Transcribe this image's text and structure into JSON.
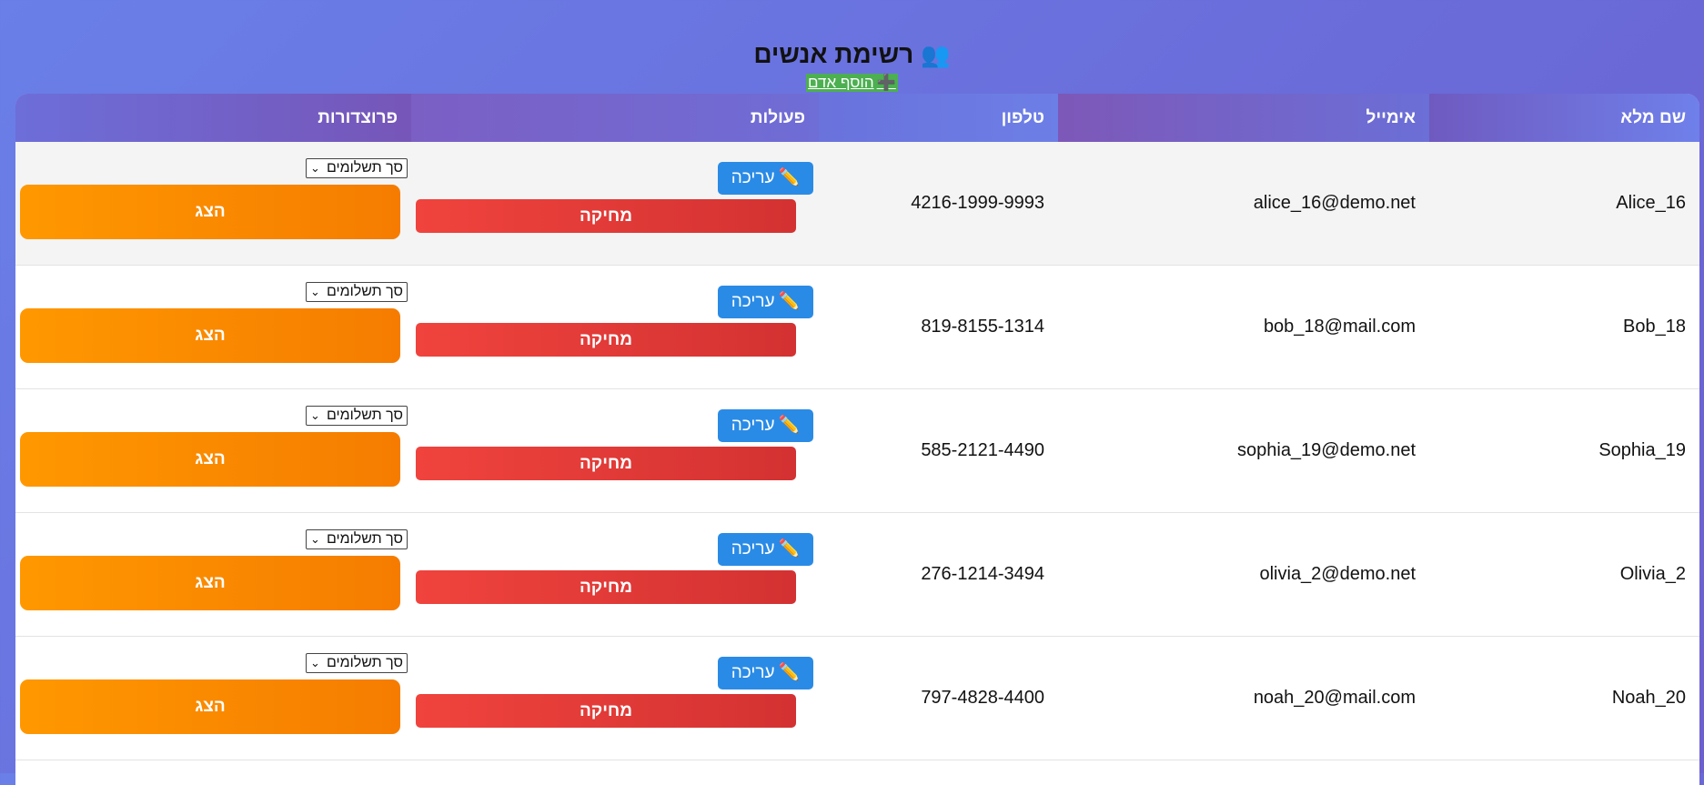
{
  "header": {
    "title": "רשימת אנשים",
    "add_person_label": "הוסף אדם"
  },
  "table": {
    "columns": {
      "name": "שם מלא",
      "email": "אימייל",
      "phone": "טלפון",
      "actions": "פעולות",
      "procedures": "פרוצדורות"
    },
    "rows": [
      {
        "name": "Alice_16",
        "email": "alice_16@demo.net",
        "phone": "4216-1999-9993"
      },
      {
        "name": "Bob_18",
        "email": "bob_18@mail.com",
        "phone": "819-8155-1314"
      },
      {
        "name": "Sophia_19",
        "email": "sophia_19@demo.net",
        "phone": "585-2121-4490"
      },
      {
        "name": "Olivia_2",
        "email": "olivia_2@demo.net",
        "phone": "276-1214-3494"
      },
      {
        "name": "Noah_20",
        "email": "noah_20@mail.com",
        "phone": "797-4828-4400"
      }
    ]
  },
  "buttons": {
    "edit": "עריכה",
    "delete": "מחיקה",
    "show": "הצג"
  },
  "select": {
    "selected": "סך תשלומים"
  },
  "icons": {
    "title": "people-icon",
    "add": "plus-icon",
    "edit": "pencil-icon",
    "select": "chevron-down-icon"
  },
  "colors": {
    "edit": "#2a8be6",
    "delete": "#e53935",
    "show": "#fb8c00",
    "add": "#4caf50"
  }
}
